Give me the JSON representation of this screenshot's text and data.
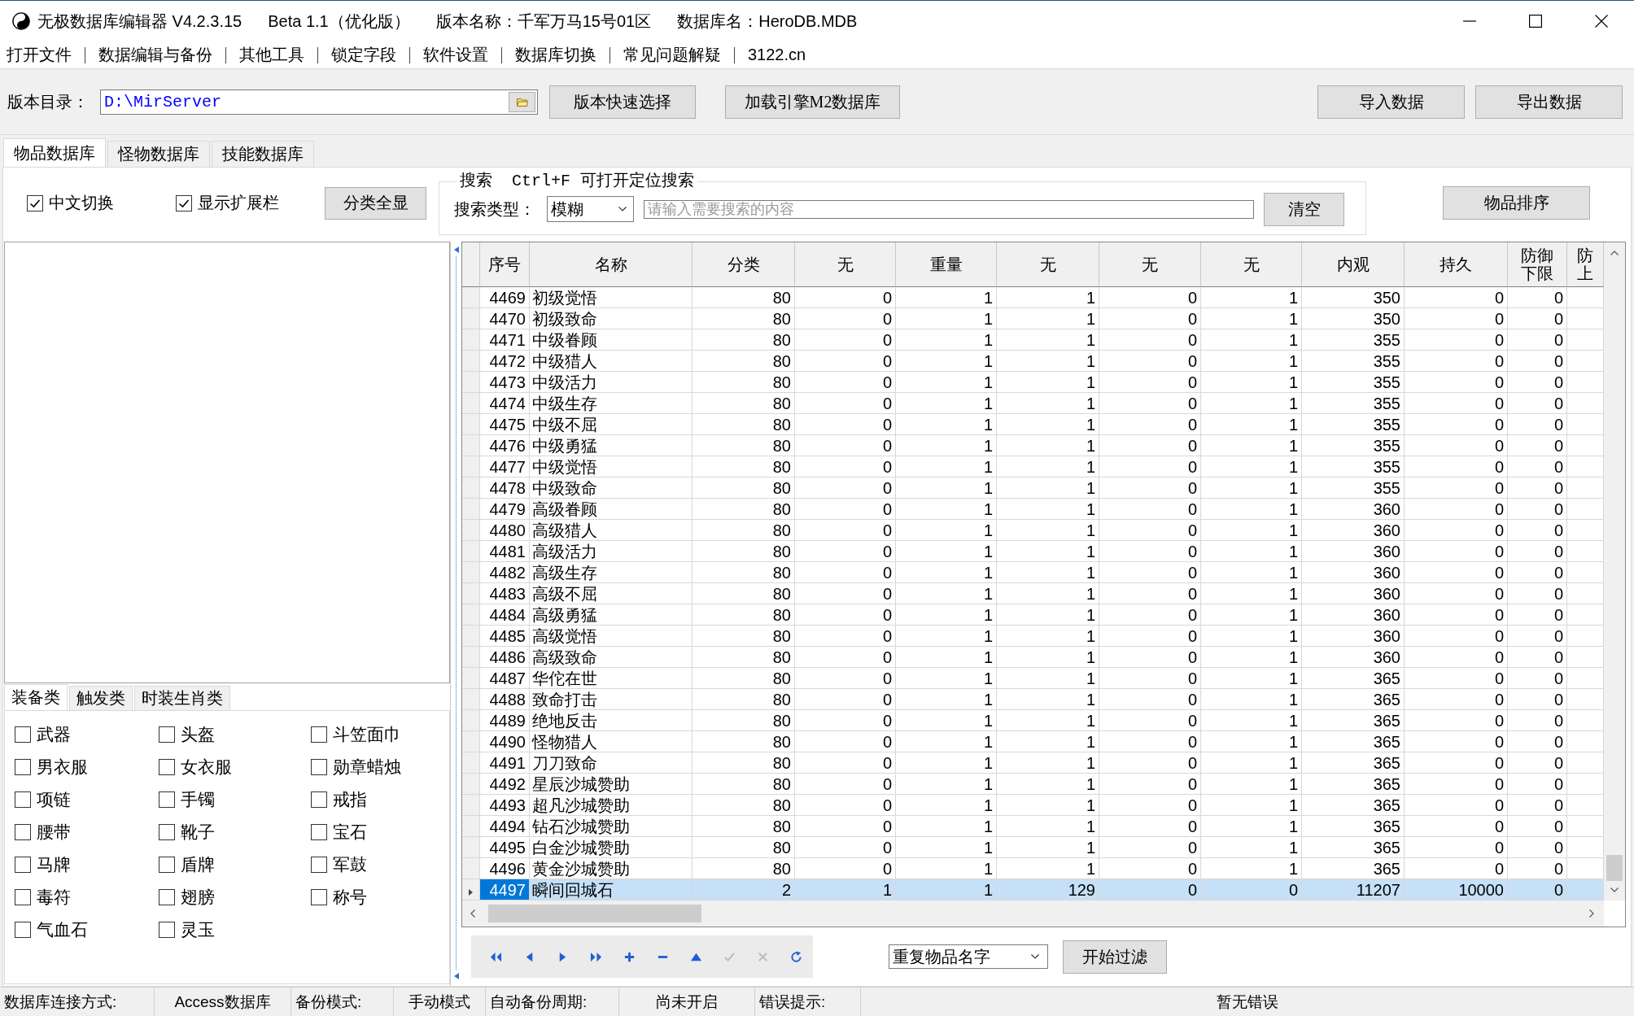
{
  "window": {
    "title_parts": [
      "无极数据库编辑器 V4.2.3.15",
      "Beta 1.1（优化版）",
      "版本名称：千军万马15号01区",
      "数据库名：HeroDB.MDB"
    ]
  },
  "menu": [
    "打开文件",
    "数据编辑与备份",
    "其他工具",
    "锁定字段",
    "软件设置",
    "数据库切换",
    "常见问题解疑",
    "3122.cn"
  ],
  "toolbar": {
    "path_label": "版本目录：",
    "path_value": "D:\\MirServer",
    "left_buttons": [
      "版本快速选择",
      "加载引擎M2数据库"
    ],
    "right_buttons": [
      "导入数据",
      "导出数据"
    ]
  },
  "tabs": [
    {
      "label": "物品数据库",
      "selected": true
    },
    {
      "label": "怪物数据库",
      "selected": false
    },
    {
      "label": "技能数据库",
      "selected": false
    }
  ],
  "filter": {
    "checkboxes": [
      {
        "label": "中文切换",
        "checked": true
      },
      {
        "label": "显示扩展栏",
        "checked": true
      }
    ],
    "show_all_button": "分类全显",
    "search": {
      "caption": "搜索",
      "hint": "Ctrl+F 可打开定位搜索",
      "type_label": "搜索类型：",
      "type_value": "模糊",
      "placeholder": "请输入需要搜索的内容",
      "clear_button": "清空"
    },
    "sort_button": "物品排序"
  },
  "category_tabs": [
    {
      "label": "装备类",
      "selected": true
    },
    {
      "label": "触发类",
      "selected": false
    },
    {
      "label": "时装生肖类",
      "selected": false
    }
  ],
  "categories": [
    {
      "label": "武器",
      "checked": false
    },
    {
      "label": "头盔",
      "checked": false
    },
    {
      "label": "斗笠面巾",
      "checked": false
    },
    {
      "label": "男衣服",
      "checked": false
    },
    {
      "label": "女衣服",
      "checked": false
    },
    {
      "label": "勋章蜡烛",
      "checked": false
    },
    {
      "label": "项链",
      "checked": false
    },
    {
      "label": "手镯",
      "checked": false
    },
    {
      "label": "戒指",
      "checked": false
    },
    {
      "label": "腰带",
      "checked": false
    },
    {
      "label": "靴子",
      "checked": false
    },
    {
      "label": "宝石",
      "checked": false
    },
    {
      "label": "马牌",
      "checked": false
    },
    {
      "label": "盾牌",
      "checked": false
    },
    {
      "label": "军鼓",
      "checked": false
    },
    {
      "label": "毒符",
      "checked": false
    },
    {
      "label": "翅膀",
      "checked": false
    },
    {
      "label": "称号",
      "checked": false
    },
    {
      "label": "气血石",
      "checked": false
    },
    {
      "label": "灵玉",
      "checked": false
    }
  ],
  "table": {
    "columns": [
      {
        "lines": [
          "序号"
        ]
      },
      {
        "lines": [
          "名称"
        ]
      },
      {
        "lines": [
          "分类"
        ]
      },
      {
        "lines": [
          "无"
        ]
      },
      {
        "lines": [
          "重量"
        ]
      },
      {
        "lines": [
          "无"
        ]
      },
      {
        "lines": [
          "无"
        ]
      },
      {
        "lines": [
          "无"
        ]
      },
      {
        "lines": [
          "内观"
        ]
      },
      {
        "lines": [
          "持久"
        ]
      },
      {
        "lines": [
          "防御",
          "下限"
        ]
      },
      {
        "lines": [
          "防",
          "上"
        ]
      }
    ],
    "rows": [
      {
        "cells": [
          "4469",
          "初级觉悟",
          "80",
          "0",
          "1",
          "1",
          "0",
          "1",
          "350",
          "0",
          "0"
        ],
        "selected": false
      },
      {
        "cells": [
          "4470",
          "初级致命",
          "80",
          "0",
          "1",
          "1",
          "0",
          "1",
          "350",
          "0",
          "0"
        ],
        "selected": false
      },
      {
        "cells": [
          "4471",
          "中级眷顾",
          "80",
          "0",
          "1",
          "1",
          "0",
          "1",
          "355",
          "0",
          "0"
        ],
        "selected": false
      },
      {
        "cells": [
          "4472",
          "中级猎人",
          "80",
          "0",
          "1",
          "1",
          "0",
          "1",
          "355",
          "0",
          "0"
        ],
        "selected": false
      },
      {
        "cells": [
          "4473",
          "中级活力",
          "80",
          "0",
          "1",
          "1",
          "0",
          "1",
          "355",
          "0",
          "0"
        ],
        "selected": false
      },
      {
        "cells": [
          "4474",
          "中级生存",
          "80",
          "0",
          "1",
          "1",
          "0",
          "1",
          "355",
          "0",
          "0"
        ],
        "selected": false
      },
      {
        "cells": [
          "4475",
          "中级不屈",
          "80",
          "0",
          "1",
          "1",
          "0",
          "1",
          "355",
          "0",
          "0"
        ],
        "selected": false
      },
      {
        "cells": [
          "4476",
          "中级勇猛",
          "80",
          "0",
          "1",
          "1",
          "0",
          "1",
          "355",
          "0",
          "0"
        ],
        "selected": false
      },
      {
        "cells": [
          "4477",
          "中级觉悟",
          "80",
          "0",
          "1",
          "1",
          "0",
          "1",
          "355",
          "0",
          "0"
        ],
        "selected": false
      },
      {
        "cells": [
          "4478",
          "中级致命",
          "80",
          "0",
          "1",
          "1",
          "0",
          "1",
          "355",
          "0",
          "0"
        ],
        "selected": false
      },
      {
        "cells": [
          "4479",
          "高级眷顾",
          "80",
          "0",
          "1",
          "1",
          "0",
          "1",
          "360",
          "0",
          "0"
        ],
        "selected": false
      },
      {
        "cells": [
          "4480",
          "高级猎人",
          "80",
          "0",
          "1",
          "1",
          "0",
          "1",
          "360",
          "0",
          "0"
        ],
        "selected": false
      },
      {
        "cells": [
          "4481",
          "高级活力",
          "80",
          "0",
          "1",
          "1",
          "0",
          "1",
          "360",
          "0",
          "0"
        ],
        "selected": false
      },
      {
        "cells": [
          "4482",
          "高级生存",
          "80",
          "0",
          "1",
          "1",
          "0",
          "1",
          "360",
          "0",
          "0"
        ],
        "selected": false
      },
      {
        "cells": [
          "4483",
          "高级不屈",
          "80",
          "0",
          "1",
          "1",
          "0",
          "1",
          "360",
          "0",
          "0"
        ],
        "selected": false
      },
      {
        "cells": [
          "4484",
          "高级勇猛",
          "80",
          "0",
          "1",
          "1",
          "0",
          "1",
          "360",
          "0",
          "0"
        ],
        "selected": false
      },
      {
        "cells": [
          "4485",
          "高级觉悟",
          "80",
          "0",
          "1",
          "1",
          "0",
          "1",
          "360",
          "0",
          "0"
        ],
        "selected": false
      },
      {
        "cells": [
          "4486",
          "高级致命",
          "80",
          "0",
          "1",
          "1",
          "0",
          "1",
          "360",
          "0",
          "0"
        ],
        "selected": false
      },
      {
        "cells": [
          "4487",
          "华佗在世",
          "80",
          "0",
          "1",
          "1",
          "0",
          "1",
          "365",
          "0",
          "0"
        ],
        "selected": false
      },
      {
        "cells": [
          "4488",
          "致命打击",
          "80",
          "0",
          "1",
          "1",
          "0",
          "1",
          "365",
          "0",
          "0"
        ],
        "selected": false
      },
      {
        "cells": [
          "4489",
          "绝地反击",
          "80",
          "0",
          "1",
          "1",
          "0",
          "1",
          "365",
          "0",
          "0"
        ],
        "selected": false
      },
      {
        "cells": [
          "4490",
          "怪物猎人",
          "80",
          "0",
          "1",
          "1",
          "0",
          "1",
          "365",
          "0",
          "0"
        ],
        "selected": false
      },
      {
        "cells": [
          "4491",
          "刀刀致命",
          "80",
          "0",
          "1",
          "1",
          "0",
          "1",
          "365",
          "0",
          "0"
        ],
        "selected": false
      },
      {
        "cells": [
          "4492",
          "星辰沙城赞助",
          "80",
          "0",
          "1",
          "1",
          "0",
          "1",
          "365",
          "0",
          "0"
        ],
        "selected": false
      },
      {
        "cells": [
          "4493",
          "超凡沙城赞助",
          "80",
          "0",
          "1",
          "1",
          "0",
          "1",
          "365",
          "0",
          "0"
        ],
        "selected": false
      },
      {
        "cells": [
          "4494",
          "钻石沙城赞助",
          "80",
          "0",
          "1",
          "1",
          "0",
          "1",
          "365",
          "0",
          "0"
        ],
        "selected": false
      },
      {
        "cells": [
          "4495",
          "白金沙城赞助",
          "80",
          "0",
          "1",
          "1",
          "0",
          "1",
          "365",
          "0",
          "0"
        ],
        "selected": false
      },
      {
        "cells": [
          "4496",
          "黄金沙城赞助",
          "80",
          "0",
          "1",
          "1",
          "0",
          "1",
          "365",
          "0",
          "0"
        ],
        "selected": false
      },
      {
        "cells": [
          "4497",
          "瞬间回城石",
          "2",
          "1",
          "1",
          "129",
          "0",
          "0",
          "11207",
          "10000",
          "0"
        ],
        "selected": true
      }
    ]
  },
  "navigator": [
    {
      "kind": "first",
      "disabled": false
    },
    {
      "kind": "prior",
      "disabled": false
    },
    {
      "kind": "next",
      "disabled": false
    },
    {
      "kind": "last",
      "disabled": false
    },
    {
      "kind": "insert",
      "disabled": false
    },
    {
      "kind": "delete",
      "disabled": false
    },
    {
      "kind": "edit",
      "disabled": false
    },
    {
      "kind": "post",
      "disabled": true
    },
    {
      "kind": "cancel",
      "disabled": true
    },
    {
      "kind": "refresh",
      "disabled": false
    }
  ],
  "filter_bar": {
    "dropdown_value": "重复物品名字",
    "start_button": "开始过滤"
  },
  "status_bar": [
    {
      "label": "数据库连接方式:",
      "value": "Access数据库"
    },
    {
      "label": "备份模式:",
      "value": "手动模式"
    },
    {
      "label": "自动备份周期:",
      "value": "尚未开启"
    },
    {
      "label": "错误提示:",
      "value": "暂无错误"
    }
  ]
}
